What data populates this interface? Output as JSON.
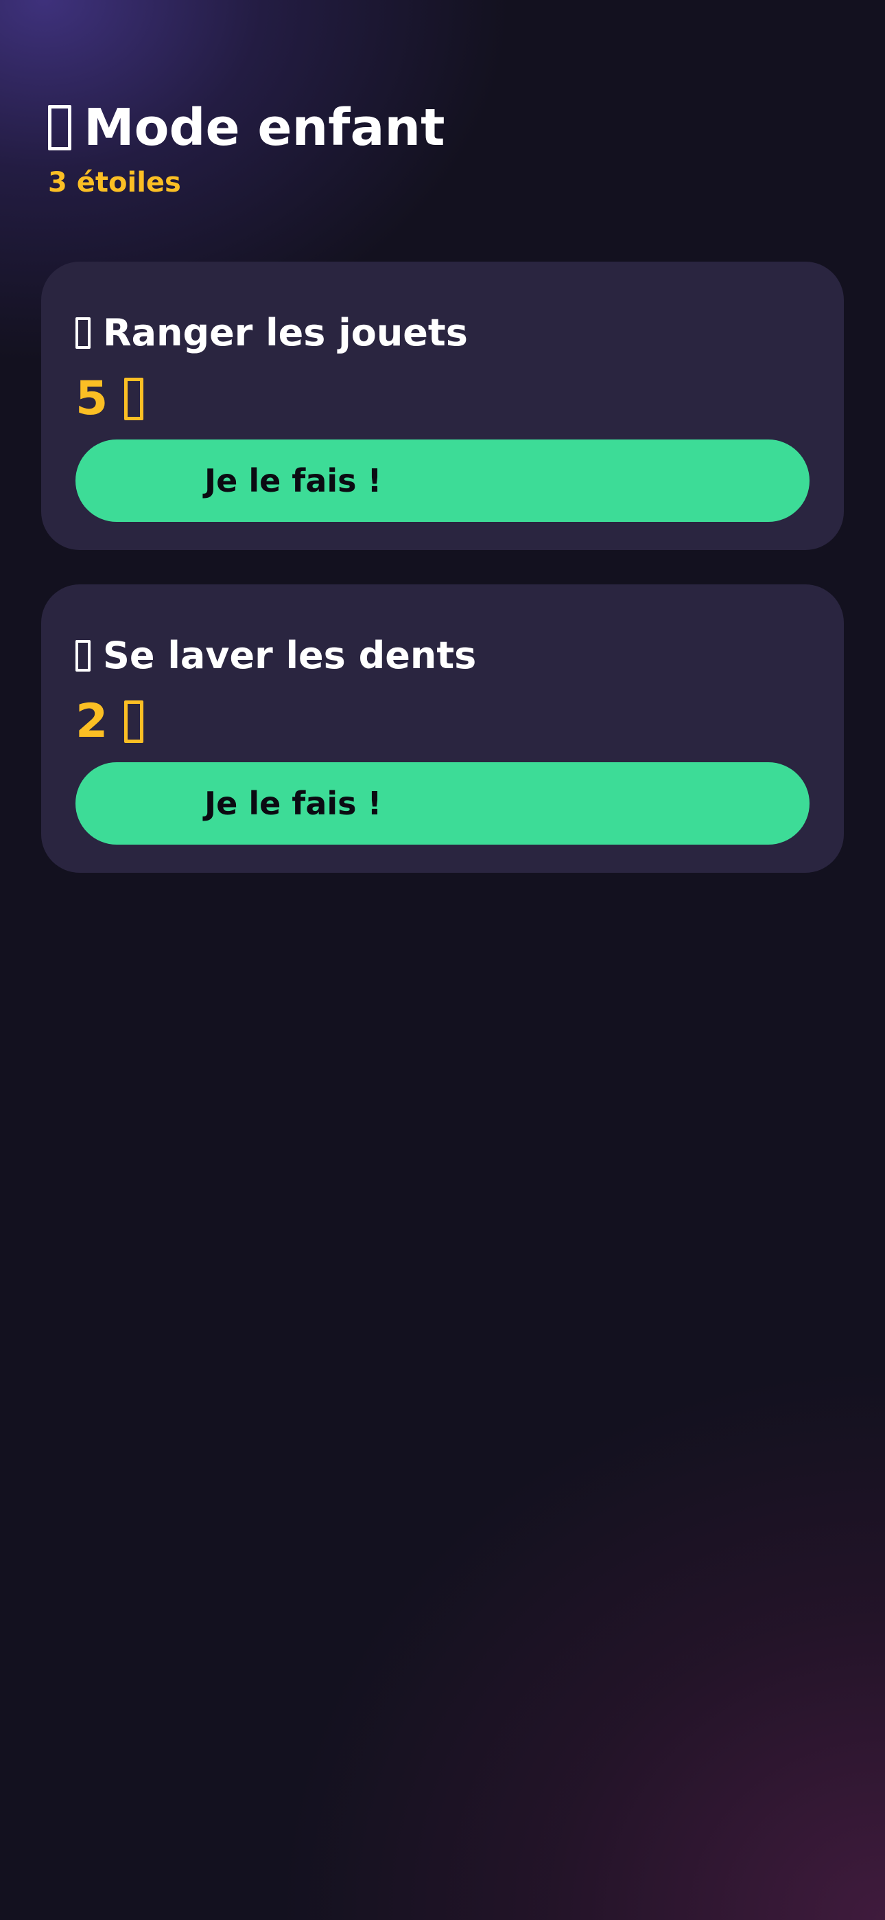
{
  "header": {
    "title": "Mode enfant",
    "stars_text": "3 étoiles"
  },
  "tasks": [
    {
      "title": "Ranger les jouets",
      "stars": "5",
      "button_label": "Je le fais !"
    },
    {
      "title": "Se laver les dents",
      "stars": "2",
      "button_label": "Je le fais !"
    }
  ],
  "icons": {
    "title_icon": "emoji-icon",
    "task_icon": "emoji-icon",
    "star_icon": "star-icon"
  },
  "colors": {
    "accent_green": "#3ddc97",
    "star_yellow": "#fbbf24",
    "card_bg": "#2a2540",
    "page_bg": "#13111f"
  }
}
